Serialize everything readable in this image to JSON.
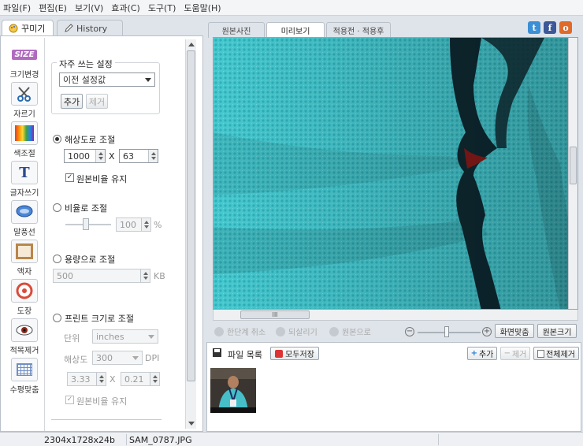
{
  "menu": [
    "파일(F)",
    "편집(E)",
    "보기(V)",
    "효과(C)",
    "도구(T)",
    "도움말(H)"
  ],
  "left_tabs": {
    "decorate": "꾸미기",
    "history": "History"
  },
  "tools": [
    {
      "label": "크기변경",
      "icon": "size-icon"
    },
    {
      "label": "자르기",
      "icon": "scissors-icon"
    },
    {
      "label": "색조절",
      "icon": "color-adjust-icon"
    },
    {
      "label": "글자쓰기",
      "icon": "text-icon"
    },
    {
      "label": "말풍선",
      "icon": "speech-bubble-icon"
    },
    {
      "label": "액자",
      "icon": "frame-icon"
    },
    {
      "label": "도장",
      "icon": "stamp-icon"
    },
    {
      "label": "적목제거",
      "icon": "eye-icon"
    },
    {
      "label": "수평맞춤",
      "icon": "grid-icon"
    }
  ],
  "size_icon_text": "SIZE",
  "presets": {
    "title": "자주 쓰는 설정",
    "selected": "이전 설정값",
    "add": "추가",
    "remove": "제거"
  },
  "resolution": {
    "label": "해상도로 조절",
    "width": "1000",
    "height": "63",
    "x": "X",
    "keep_ratio": "원본비율 유지",
    "checked": "✓"
  },
  "ratio": {
    "label": "비율로 조절",
    "value": "100",
    "unit": "%"
  },
  "capacity": {
    "label": "용량으로 조절",
    "value": "500",
    "unit": "KB"
  },
  "print": {
    "label": "프린트 크기로 조절",
    "unit_label": "단위",
    "unit_value": "inches",
    "res_label": "해상도",
    "res_value": "300",
    "res_unit": "DPI",
    "width": "3.33",
    "height": "0.21",
    "x": "X",
    "keep_ratio": "원본비율 유지",
    "checked": "✓"
  },
  "right_tabs": [
    "원본사진",
    "미리보기",
    "적용전 · 적용후"
  ],
  "social": [
    {
      "t": "t",
      "color": "#3b8fd6"
    },
    {
      "t": "f",
      "color": "#3b5998"
    },
    {
      "t": "o",
      "color": "#e06a2a"
    }
  ],
  "hscroll_grip": "III",
  "toolbar": {
    "undo": "한단계 취소",
    "redo": "되살리기",
    "original": "원본으로",
    "fit": "화면맞춤",
    "actual": "원본크기"
  },
  "files": {
    "title": "파일 목록",
    "save_all": "모두저장",
    "add": "추가",
    "remove": "제거",
    "remove_all": "전체제거"
  },
  "status": {
    "dimensions": "2304x1728x24b",
    "filename": "SAM_0787.JPG"
  }
}
